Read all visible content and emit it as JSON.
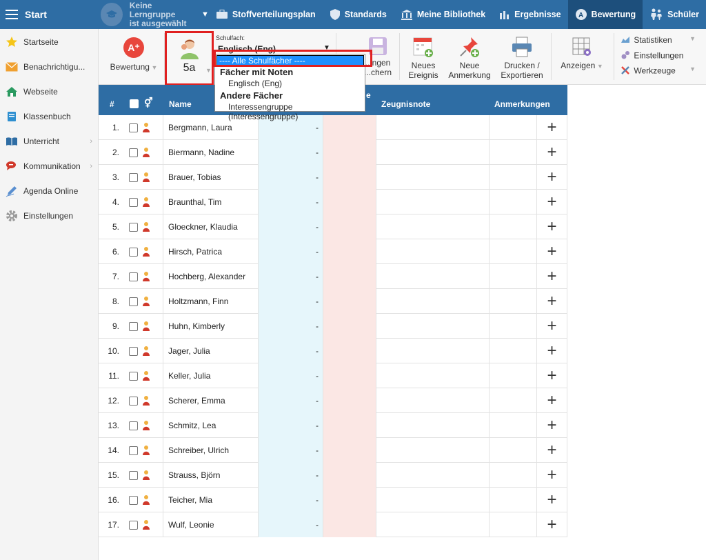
{
  "topbar": {
    "start": "Start",
    "lerngruppe": [
      "Keine Lerngruppe",
      "ist ausgewählt"
    ],
    "nav": [
      "Stoffverteilungsplan",
      "Standards",
      "Meine Bibliothek",
      "Ergebnisse",
      "Bewertung",
      "Schüler"
    ]
  },
  "sidebar": [
    "Startseite",
    "Benachrichtigu...",
    "Webseite",
    "Klassenbuch",
    "Unterricht",
    "Kommunikation",
    "Agenda Online",
    "Einstellungen"
  ],
  "toolbar": {
    "bewertung": "Bewertung",
    "klasse": "5a",
    "schulfach_label": "Schulfach:",
    "schulfach_value": "Englisch (Eng)",
    "speichern": [
      "...ngen",
      "...chern"
    ],
    "neues_ereignis": [
      "Neues",
      "Ereignis"
    ],
    "neue_anmerkung": [
      "Neue",
      "Anmerkung"
    ],
    "drucken": [
      "Drucken /",
      "Exportieren"
    ],
    "anzeigen": "Anzeigen",
    "statistiken": "Statistiken",
    "einstellungen": "Einstellungen",
    "werkzeuge": "Werkzeuge"
  },
  "dropdown": {
    "selected": "---- Alle Schulfächer ----",
    "group1": "Fächer mit Noten",
    "opt1": "Englisch (Eng)",
    "group2": "Andere Fächer",
    "opt2": "Interessengruppe (Interessengruppe)"
  },
  "table": {
    "headers": {
      "num": "#",
      "name": "Name",
      "partial": "e",
      "zeugnisnote": "Zeugnisnote",
      "anmerkungen": "Anmerkungen"
    },
    "rows": [
      {
        "num": "1.",
        "name": "Bergmann, Laura",
        "val": "-"
      },
      {
        "num": "2.",
        "name": "Biermann, Nadine",
        "val": "-"
      },
      {
        "num": "3.",
        "name": "Brauer, Tobias",
        "val": "-"
      },
      {
        "num": "4.",
        "name": "Braunthal, Tim",
        "val": "-"
      },
      {
        "num": "5.",
        "name": "Gloeckner, Klaudia",
        "val": "-"
      },
      {
        "num": "6.",
        "name": "Hirsch, Patrica",
        "val": "-"
      },
      {
        "num": "7.",
        "name": "Hochberg, Alexander",
        "val": "-"
      },
      {
        "num": "8.",
        "name": "Holtzmann, Finn",
        "val": "-"
      },
      {
        "num": "9.",
        "name": "Huhn, Kimberly",
        "val": "-"
      },
      {
        "num": "10.",
        "name": "Jager, Julia",
        "val": "-"
      },
      {
        "num": "11.",
        "name": "Keller, Julia",
        "val": "-"
      },
      {
        "num": "12.",
        "name": "Scherer, Emma",
        "val": "-"
      },
      {
        "num": "13.",
        "name": "Schmitz, Lea",
        "val": "-"
      },
      {
        "num": "14.",
        "name": "Schreiber, Ulrich",
        "val": "-"
      },
      {
        "num": "15.",
        "name": "Strauss, Björn",
        "val": "-"
      },
      {
        "num": "16.",
        "name": "Teicher, Mia",
        "val": "-"
      },
      {
        "num": "17.",
        "name": "Wulf, Leonie",
        "val": "-"
      }
    ]
  }
}
